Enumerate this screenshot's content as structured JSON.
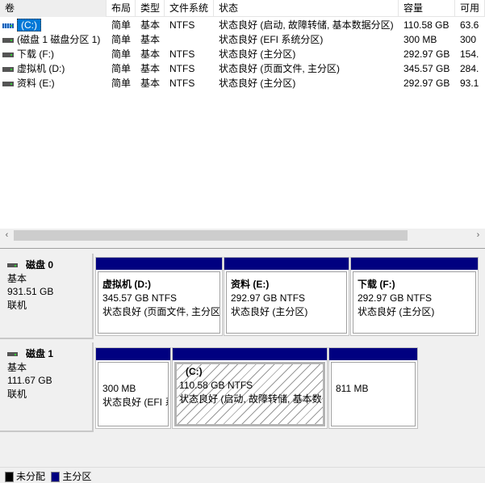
{
  "columns": [
    "卷",
    "布局",
    "类型",
    "文件系统",
    "状态",
    "容量",
    "可用"
  ],
  "volumes": [
    {
      "name": "(C:)",
      "layout": "简单",
      "type": "基本",
      "fs": "NTFS",
      "status": "状态良好 (启动, 故障转储, 基本数据分区)",
      "capacity": "110.58 GB",
      "free": "63.6",
      "icon": "system-drive-icon"
    },
    {
      "name": "(磁盘 1 磁盘分区 1)",
      "layout": "简单",
      "type": "基本",
      "fs": "",
      "status": "状态良好 (EFI 系统分区)",
      "capacity": "300 MB",
      "free": "300",
      "icon": "drive-icon"
    },
    {
      "name": "下载 (F:)",
      "layout": "简单",
      "type": "基本",
      "fs": "NTFS",
      "status": "状态良好 (主分区)",
      "capacity": "292.97 GB",
      "free": "154.",
      "icon": "drive-icon"
    },
    {
      "name": "虚拟机 (D:)",
      "layout": "简单",
      "type": "基本",
      "fs": "NTFS",
      "status": "状态良好 (页面文件, 主分区)",
      "capacity": "345.57 GB",
      "free": "284.",
      "icon": "drive-icon"
    },
    {
      "name": "资料 (E:)",
      "layout": "简单",
      "type": "基本",
      "fs": "NTFS",
      "status": "状态良好 (主分区)",
      "capacity": "292.97 GB",
      "free": "93.1",
      "icon": "drive-icon"
    }
  ],
  "disks": [
    {
      "name": "磁盘 0",
      "type": "基本",
      "size": "931.51 GB",
      "state": "联机",
      "partitions": [
        {
          "title": "虚拟机  (D:)",
          "size": "345.57 GB NTFS",
          "status": "状态良好 (页面文件, 主分区"
        },
        {
          "title": "资料  (E:)",
          "size": "292.97 GB NTFS",
          "status": "状态良好 (主分区)"
        },
        {
          "title": "下载  (F:)",
          "size": "292.97 GB NTFS",
          "status": "状态良好 (主分区)"
        }
      ]
    },
    {
      "name": "磁盘 1",
      "type": "基本",
      "size": "111.67 GB",
      "state": "联机",
      "partitions": [
        {
          "title": "",
          "size": "300 MB",
          "status": "状态良好 (EFI 系统"
        },
        {
          "title": "(C:)",
          "size": "110.58 GB NTFS",
          "status": "状态良好 (启动, 故障转储, 基本数"
        },
        {
          "title": "",
          "size": "811 MB",
          "status": ""
        }
      ]
    }
  ],
  "legend": [
    {
      "label": "未分配",
      "color": "#000000"
    },
    {
      "label": "主分区",
      "color": "#000080"
    }
  ],
  "colors": {
    "primary_partition": "#000080",
    "selection": "#0078d7"
  }
}
